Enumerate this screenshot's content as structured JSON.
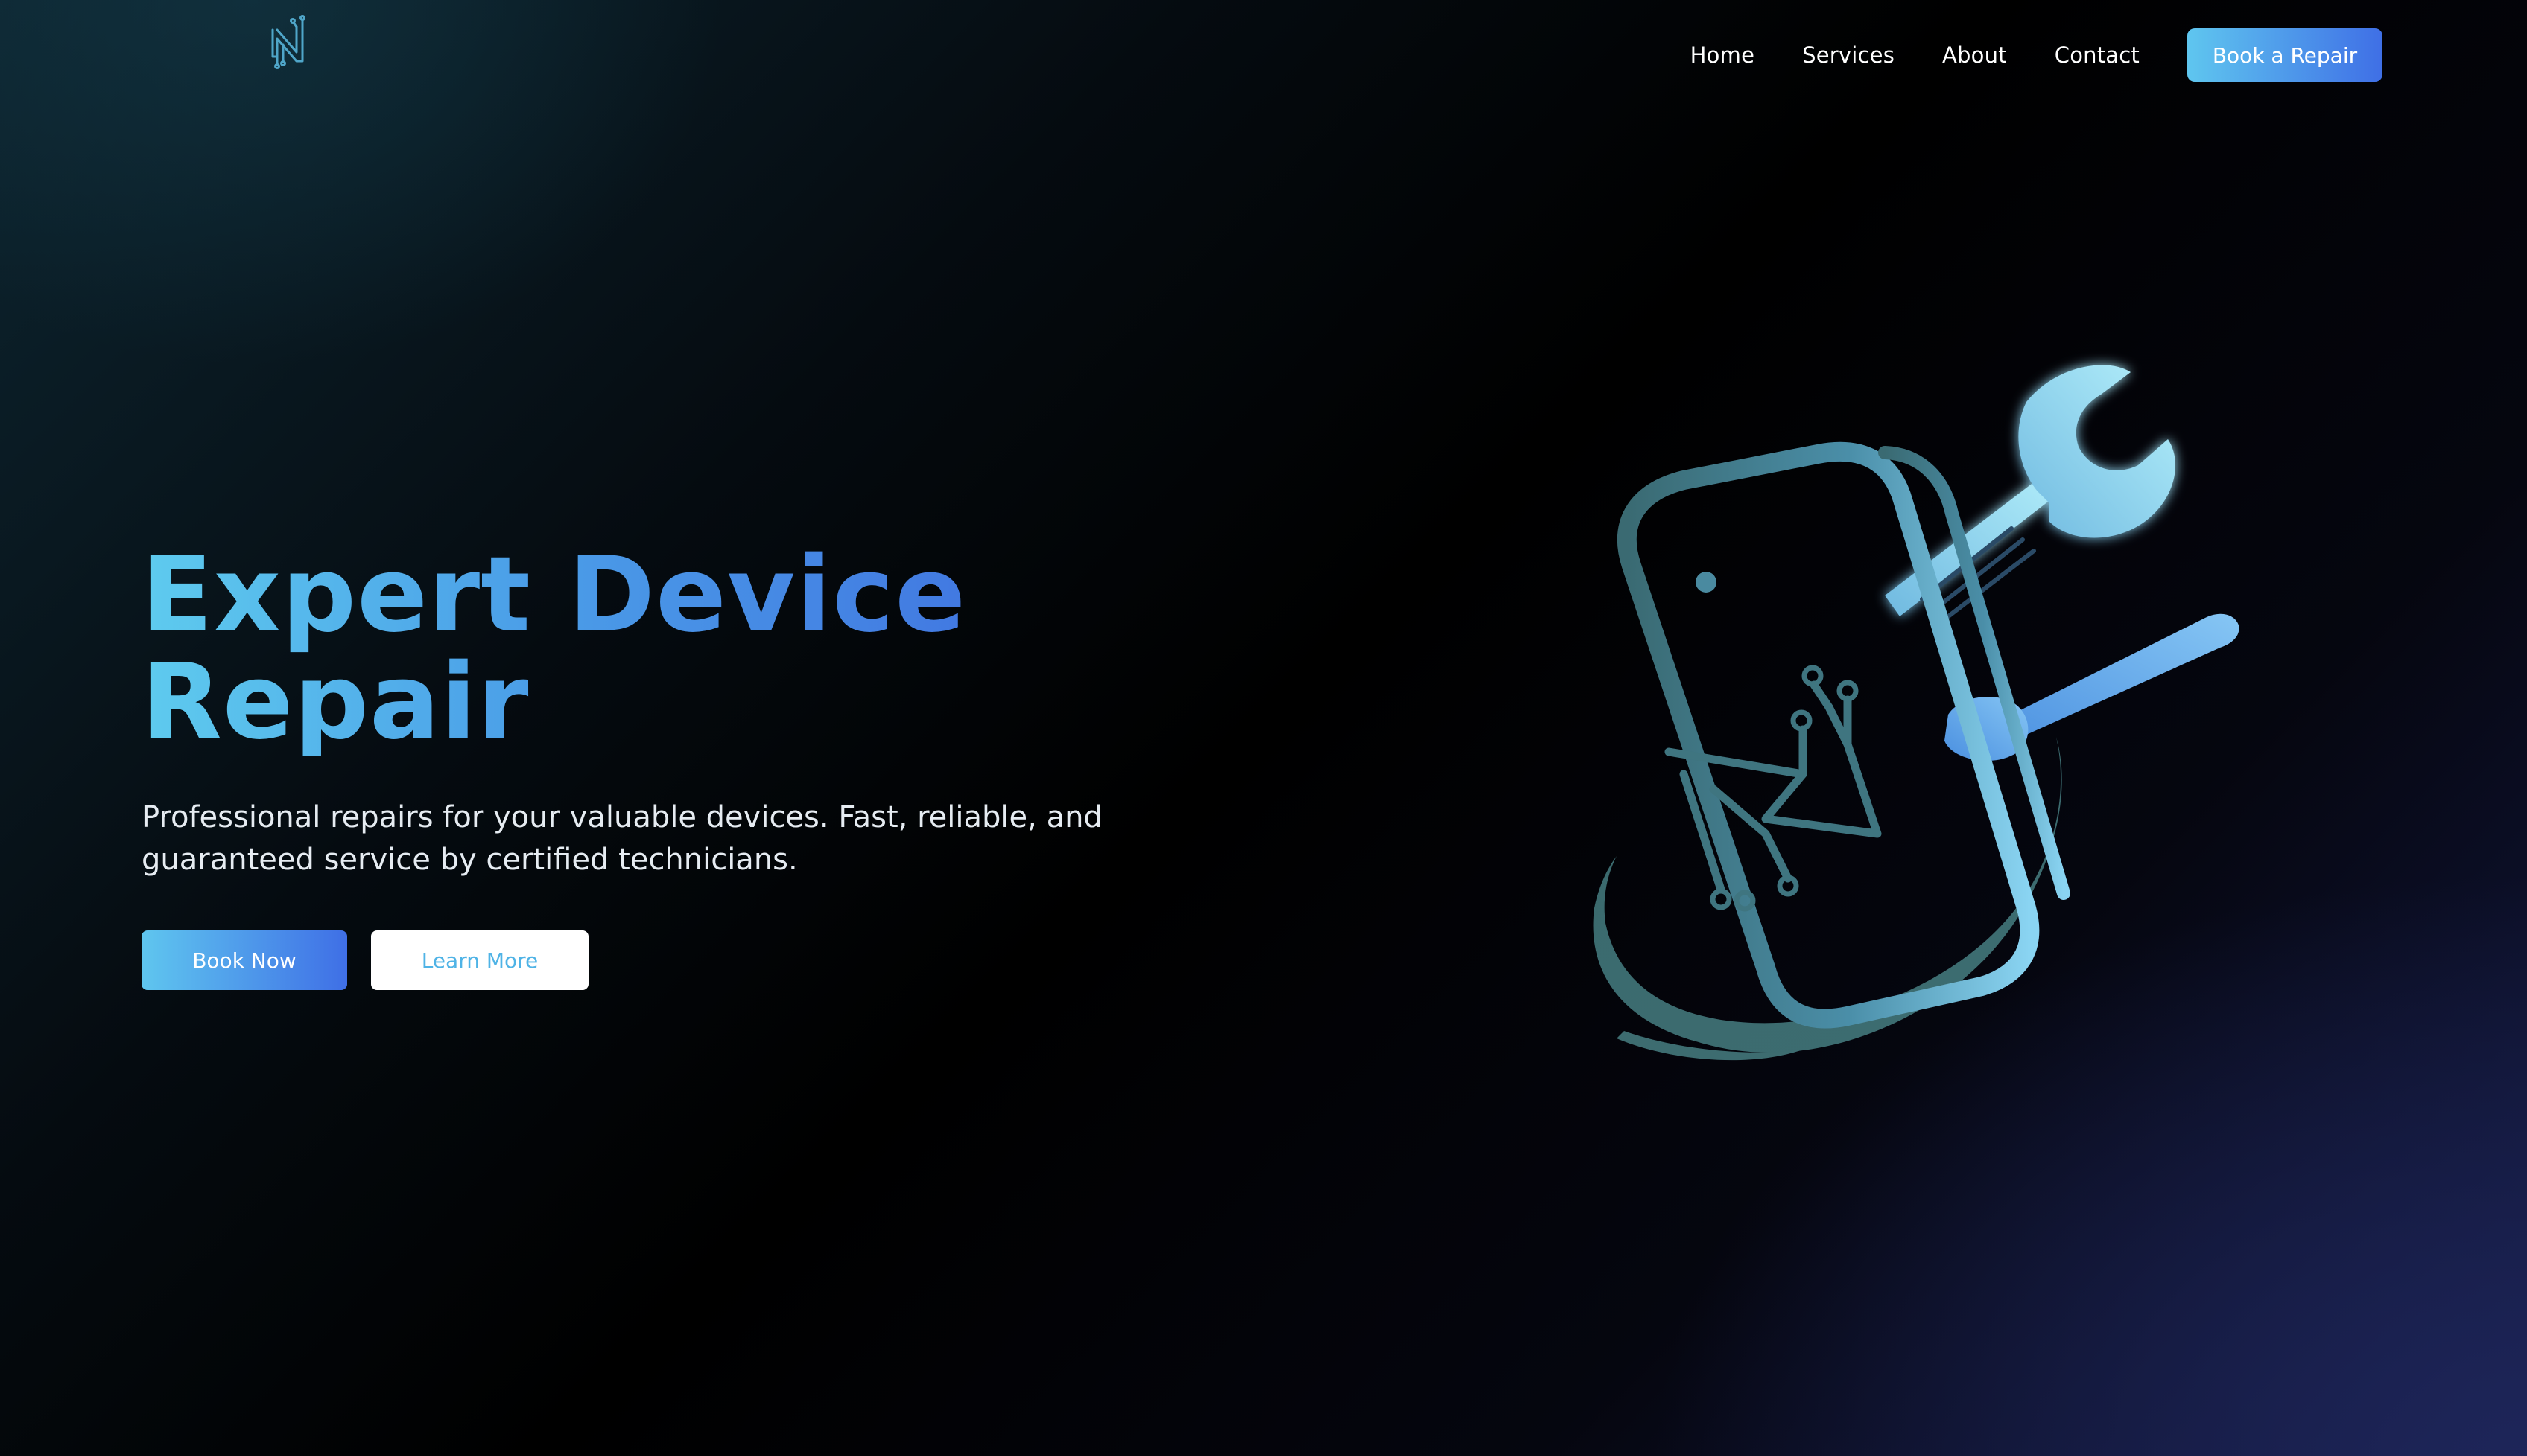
{
  "header": {
    "nav": [
      {
        "label": "Home"
      },
      {
        "label": "Services"
      },
      {
        "label": "About"
      },
      {
        "label": "Contact"
      }
    ],
    "cta_label": "Book a Repair"
  },
  "hero": {
    "title_line1": "Expert Device",
    "title_line2": "Repair",
    "subtitle": "Professional repairs for your valuable devices. Fast, reliable, and guaranteed service by certified technicians.",
    "primary_button": "Book Now",
    "secondary_button": "Learn More"
  },
  "icons": {
    "logo": "circuit-n-logo-icon",
    "illustration": "phone-wrench-screwdriver-icon"
  },
  "colors": {
    "accent_start": "#5fc6ef",
    "accent_end": "#3f6fe6",
    "background": "#000000",
    "illustration_teal": "#3d6b70",
    "illustration_light": "#a9ecfb"
  }
}
